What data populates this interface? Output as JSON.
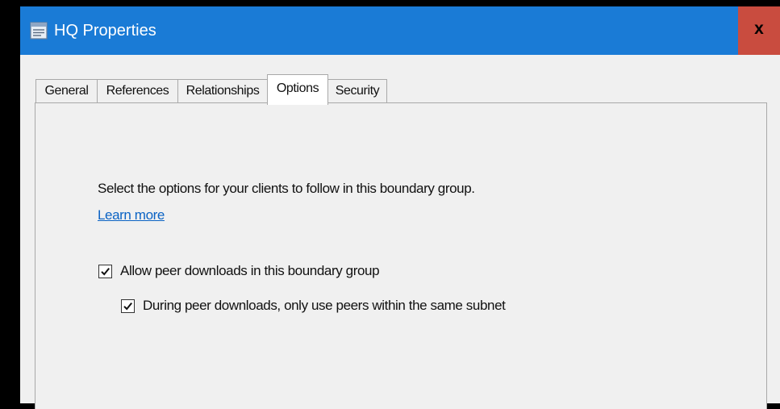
{
  "window": {
    "title": "HQ Properties",
    "title_icon": "properties-page-icon",
    "close_label": "x"
  },
  "tabs": [
    {
      "label": "General",
      "active": false
    },
    {
      "label": "References",
      "active": false
    },
    {
      "label": "Relationships",
      "active": false
    },
    {
      "label": "Options",
      "active": true
    },
    {
      "label": "Security",
      "active": false
    }
  ],
  "options_panel": {
    "description": "Select the options for your clients to follow in this boundary group.",
    "learn_more_link": "Learn more",
    "checkboxes": [
      {
        "label": "Allow peer downloads in this boundary group",
        "checked": true
      },
      {
        "label": "During peer downloads, only use peers within the same subnet",
        "checked": true
      }
    ]
  },
  "colors": {
    "titlebar": "#1a7bd6",
    "close_button": "#c94c3f",
    "dialog_background": "#f0f0f0",
    "link": "#0b63c4"
  }
}
